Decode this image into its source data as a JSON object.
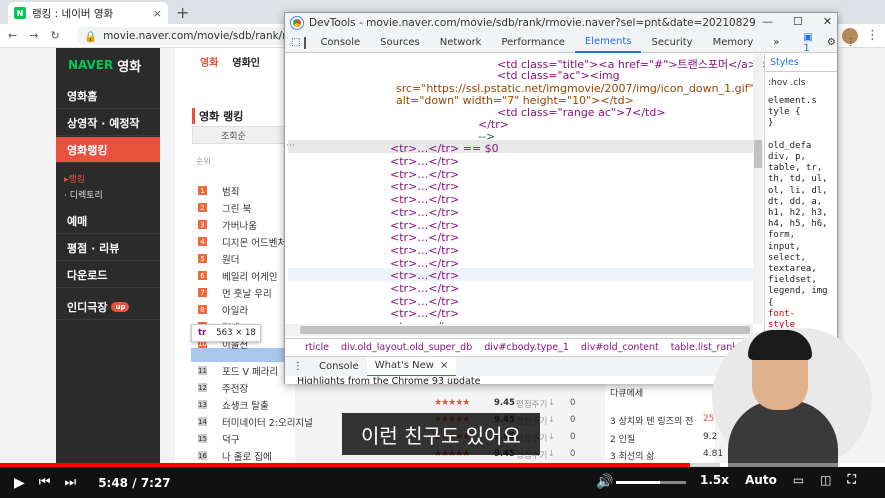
{
  "browser": {
    "tab_title": "랭킹 : 네이버 영화",
    "tab_close": "×",
    "new_tab": "+",
    "url": "movie.naver.com/movie/sdb/rank/rmovie.n",
    "menu": "⋮"
  },
  "naver": {
    "logo_naver": "NAVER",
    "logo_movie": "영화",
    "sidebar": [
      {
        "label": "영화홈"
      },
      {
        "label": "상영작 · 예정작"
      },
      {
        "label": "영화랭킹"
      },
      {
        "label": "예매"
      },
      {
        "label": "평점 · 리뷰"
      },
      {
        "label": "다운로드"
      },
      {
        "label": "인디극장"
      }
    ],
    "sidebar_sub": [
      "▸랭킹",
      "· 디렉토리"
    ],
    "up_badge": "up",
    "nav": [
      "영화",
      "영화인"
    ],
    "rank_title": "영화 랭킹",
    "sort_tab": "조회순",
    "col_head": "순위",
    "movies": [
      {
        "rank": "1",
        "title": "범죄"
      },
      {
        "rank": "2",
        "title": "그린 북"
      },
      {
        "rank": "3",
        "title": "가버나움"
      },
      {
        "rank": "4",
        "title": "디지몬 어드벤처"
      },
      {
        "rank": "5",
        "title": "원더"
      },
      {
        "rank": "6",
        "title": "베일리 어게인"
      },
      {
        "rank": "7",
        "title": "먼 훗날 우리"
      },
      {
        "rank": "8",
        "title": "아일라"
      },
      {
        "rank": "9",
        "title": "덩케"
      },
      {
        "rank": "10",
        "title": "이솔션"
      },
      {
        "rank": "11",
        "title": "포드 V 페라리"
      },
      {
        "rank": "12",
        "title": "주전장"
      },
      {
        "rank": "13",
        "title": "쇼생크 탈출"
      },
      {
        "rank": "14",
        "title": "터미네이터 2:오리지널"
      },
      {
        "rank": "15",
        "title": "덕구"
      },
      {
        "rank": "16",
        "title": "나 홀로 집에"
      }
    ],
    "lower_rows": [
      {
        "stars": "★★★★★",
        "score": "9.45",
        "pick": "평점주기",
        "arrow": "↓",
        "change": "0"
      },
      {
        "stars": "★★★★★",
        "score": "9.45",
        "pick": "평점주기",
        "arrow": "↓",
        "change": "0"
      },
      {
        "stars": "★★★★★",
        "score": "9.45",
        "pick": "평점주기",
        "arrow": "↓",
        "change": "0"
      },
      {
        "stars": "★★★★★",
        "score": "9.45",
        "pick": "평점주기",
        "arrow": "↓",
        "change": "0"
      }
    ],
    "right_items": [
      {
        "text": "다큐메세"
      },
      {
        "text": "3 상치와 텐 링즈의 전",
        "val": "25"
      },
      {
        "text": "2 인질",
        "val": "9.2"
      },
      {
        "text": "3 최선의 삶",
        "val": "4.81"
      }
    ]
  },
  "tooltip": {
    "tag": "tr",
    "size": "563 × 18"
  },
  "devtools": {
    "title": "DevTools - movie.naver.com/movie/sdb/rank/rmovie.naver?sel=pnt&date=20210829",
    "window_controls": [
      "—",
      "☐",
      "✕"
    ],
    "tabs": [
      "Console",
      "Sources",
      "Network",
      "Performance",
      "Elements",
      "Security",
      "Memory",
      "»"
    ],
    "active_tab": "Elements",
    "issues": "1",
    "code_lines": [
      "<td class=\"title\"><a href=\"#\">트랜스포머</a></td>",
      "<td class=\"ac\"><img",
      "src=\"https://ssl.pstatic.net/imgmovie/2007/img/icon_down_1.gif\"",
      "alt=\"down\" width=\"7\" height=\"10\"></td>",
      "<td class=\"range ac\">7</td>",
      "</tr>",
      "-->"
    ],
    "selected_row": "<tr>…</tr> == $0",
    "collapsed_row": "<tr>…</tr>",
    "collapsed_count": 14,
    "styles_tab": "Styles",
    "styles_filter": ":hov .cls",
    "styles_lines": [
      "element.s",
      "tyle {",
      "}",
      "",
      "old_defa",
      "div, p,",
      "table, tr,",
      "th, td, ul,",
      "ol, li, dl,",
      "dt, dd, a,",
      "h1, h2, h3,",
      "h4, h5, h6,",
      "form,",
      "input,",
      "select,",
      "textarea,",
      "fieldset,",
      "legend, img",
      "{",
      "  font-",
      "    style"
    ],
    "breadcrumbs": [
      "rticle",
      "div.old_layout.old_super_db",
      "div#cbody.type_1",
      "div#old_content",
      "table.list_ranking",
      "tbody",
      "tr"
    ],
    "drawer_tabs": [
      "Console",
      "What's New"
    ],
    "drawer_close": "×",
    "drawer_text": "Highlights from the Chrome 93 update"
  },
  "video": {
    "subtitle": "이런 친구도 있어요",
    "time_current": "5:48",
    "time_sep": "/",
    "time_total": "7:27",
    "speed": "1.5x",
    "quality": "Auto",
    "progress": 0.78
  }
}
